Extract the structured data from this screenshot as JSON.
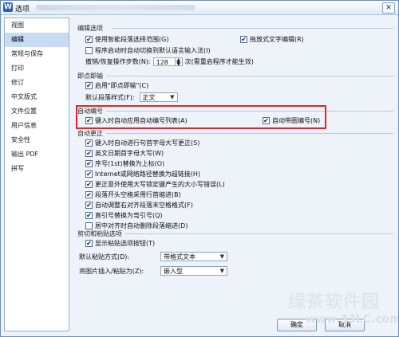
{
  "window": {
    "title": "选项",
    "app_icon": "W"
  },
  "sidebar": {
    "items": [
      {
        "label": "视图"
      },
      {
        "label": "编辑"
      },
      {
        "label": "常规与保存"
      },
      {
        "label": "打印"
      },
      {
        "label": "修订"
      },
      {
        "label": "中文版式"
      },
      {
        "label": "文件位置"
      },
      {
        "label": "用户信息"
      },
      {
        "label": "安全性"
      },
      {
        "label": "输出 PDF"
      },
      {
        "label": "拼写"
      }
    ],
    "selected": "编辑"
  },
  "editing": {
    "header": "编辑选项",
    "smart_select": {
      "label": "使用智能段落选择范围(G)",
      "checked": true
    },
    "drag_drop": {
      "label": "拖放式文字编辑(R)",
      "checked": true
    },
    "ime_default": {
      "label": "程序启动时自动切换到默认语言输入法(I)",
      "checked": false
    },
    "undo_label": "撤销/恢复操作步数(N):",
    "undo_value": "128",
    "undo_note": "次(需重启程序才能生效)"
  },
  "click_type": {
    "header": "即点即输",
    "enable": {
      "label": "启用\"即点即输\"(C)",
      "checked": true
    },
    "default_style_label": "默认段落样式(F):",
    "default_style_value": "正文"
  },
  "auto_number": {
    "header": "自动编号",
    "apply_lists": {
      "label": "键入时自动应用自动编号列表(A)",
      "checked": true
    },
    "auto_bullets": {
      "label": "自动带圈编号(N)",
      "checked": true
    }
  },
  "autocorrect": {
    "header": "自动更正",
    "items": [
      {
        "label": "键入时自动进行句首字母大写更正(S)",
        "checked": true
      },
      {
        "label": "英文日期首字母大写(W)",
        "checked": true
      },
      {
        "label": "序号(1st)替换为上标(O)",
        "checked": true
      },
      {
        "label": "Internet或网络路径替换为超链接(H)",
        "checked": true
      },
      {
        "label": "更正意外使用大写锁定键产生的大小写错误(L)",
        "checked": true
      },
      {
        "label": "段落开头空格采用行首缩进(B)",
        "checked": true
      },
      {
        "label": "自动调整右对齐段落末空格格式(F)",
        "checked": true
      },
      {
        "label": "直引号替换为弯引号(Q)",
        "checked": true
      },
      {
        "label": "居中对齐时自动删除段落缩进(D)",
        "checked": false
      }
    ]
  },
  "clipboard": {
    "header": "剪切和粘贴选项",
    "show_paste_btn": {
      "label": "显示粘贴选项按钮(T)",
      "checked": true
    },
    "default_paste_label": "默认粘贴方式(D):",
    "default_paste_value": "带格式文本",
    "image_insert_label": "将图片插入/粘贴为(Z):",
    "image_insert_value": "嵌入型"
  },
  "buttons": {
    "ok": "确定",
    "cancel": "取消"
  },
  "watermark": {
    "text": "绿茶软件园",
    "url": "www.33LC.com"
  },
  "colors": {
    "highlight": "#e0242a",
    "selected_item": "#c7dbf5",
    "window_bg": "#eef3fa"
  }
}
